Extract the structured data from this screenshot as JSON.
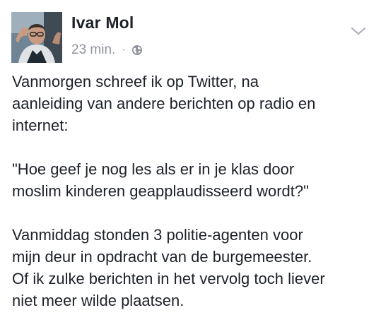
{
  "post": {
    "author": "Ivar Mol",
    "timestamp": "23 min.",
    "separator": "·",
    "audience_icon": "globe-icon",
    "menu_icon": "chevron-down-icon",
    "paragraphs": [
      "Vanmorgen schreef ik op Twitter, na\naanleiding van andere berichten op radio en\ninternet:",
      "\"Hoe geef je nog les als er in je klas door\nmoslim kinderen geapplaudisseerd wordt?\"",
      "Vanmiddag stonden 3 politie-agenten voor\nmijn deur in opdracht van de burgemeester.\nOf ik zulke berichten in het vervolg toch liever\nniet meer wilde plaatsen."
    ]
  },
  "colors": {
    "text": "#1d2129",
    "meta": "#90949c",
    "background": "#ffffff"
  }
}
